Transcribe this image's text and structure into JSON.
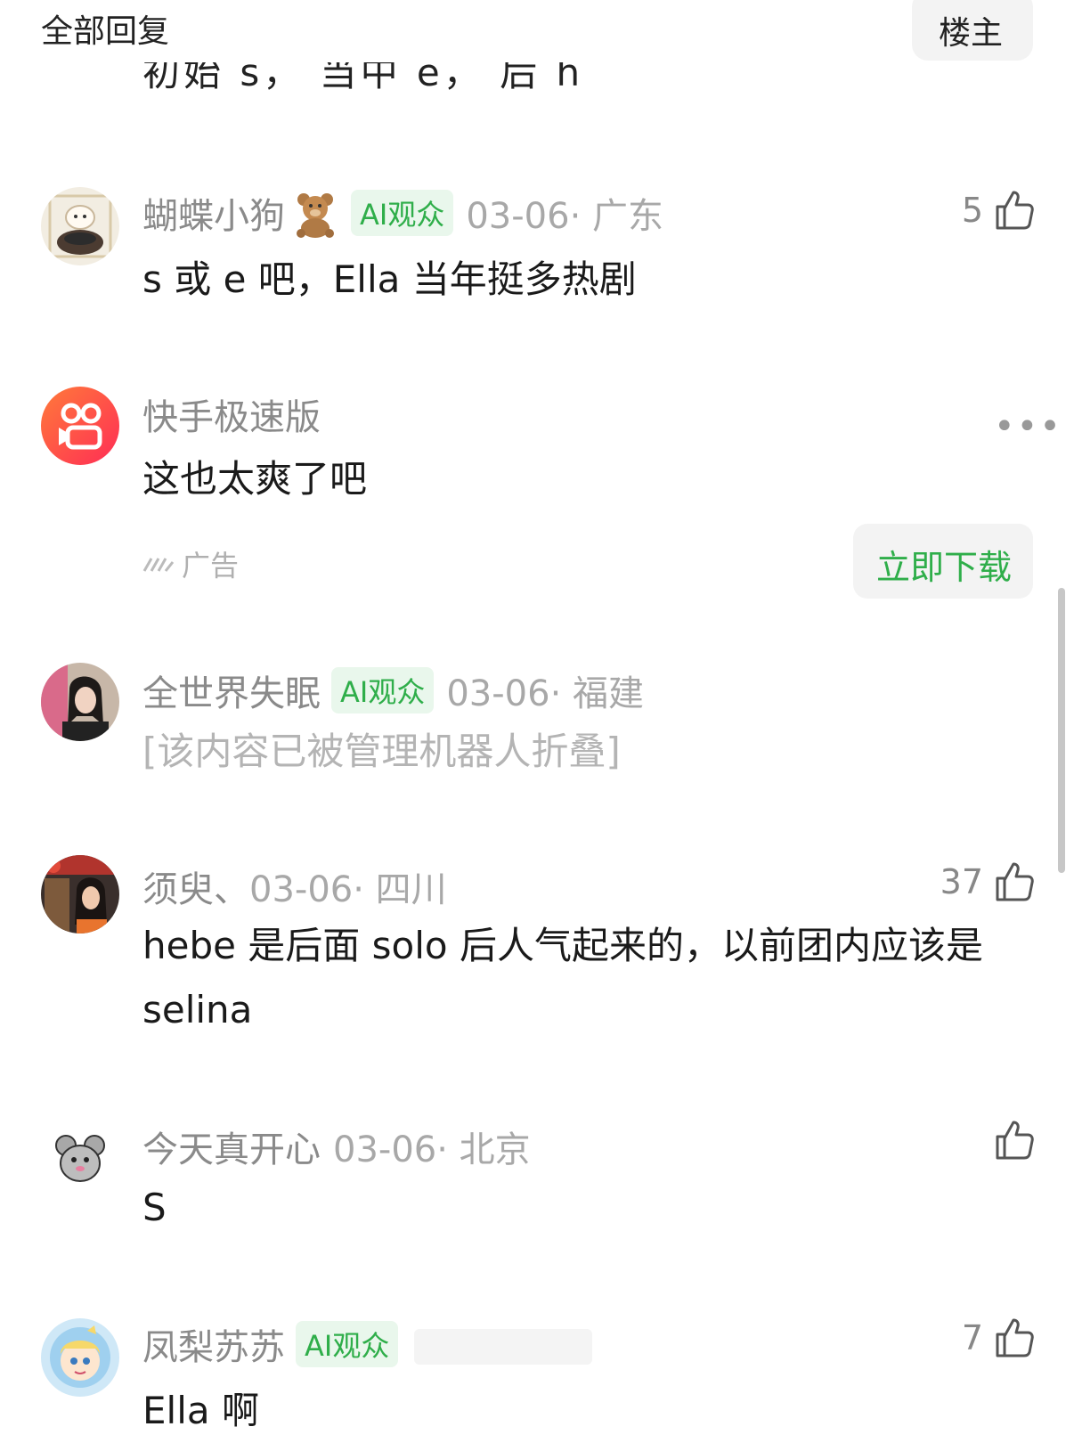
{
  "header": {
    "title": "全部回复",
    "owner_button": "楼主"
  },
  "prev_tail": "初始 s，  当中 e，  后 h",
  "comments": [
    {
      "name": "蝴蝶小狗",
      "emoji_badge": "teddy-bear",
      "ai_badge": "AI观众",
      "time": "03-06· 广东",
      "text": "s 或 e 吧，Ella 当年挺多热剧",
      "likes": "5"
    },
    {
      "ad_name": "快手极速版",
      "ad_text": "这也太爽了吧",
      "ad_label": "广告",
      "ad_button": "立即下载"
    },
    {
      "name": "全世界失眠",
      "ai_badge": "AI观众",
      "time": "03-06· 福建",
      "text": "[该内容已被管理机器人折叠]"
    },
    {
      "name": "须臾、",
      "time": "03-06· 四川",
      "text": "hebe 是后面 solo 后人气起来的，以前团内应该是 selina",
      "likes": "37"
    },
    {
      "name": "今天真开心",
      "time": "03-06· 北京",
      "text": "S",
      "likes": ""
    },
    {
      "name": "凤梨苏苏",
      "ai_badge": "AI观众",
      "time": "",
      "text": "Ella 啊",
      "likes": "7"
    }
  ],
  "icons": {
    "thumb": "thumbs-up-icon",
    "more": "more-dots-icon",
    "ad": "ad-mark-icon"
  },
  "colors": {
    "accent_green": "#2fae4a",
    "badge_bg": "#e9f7ec",
    "meta_gray": "#a8a8a8"
  }
}
